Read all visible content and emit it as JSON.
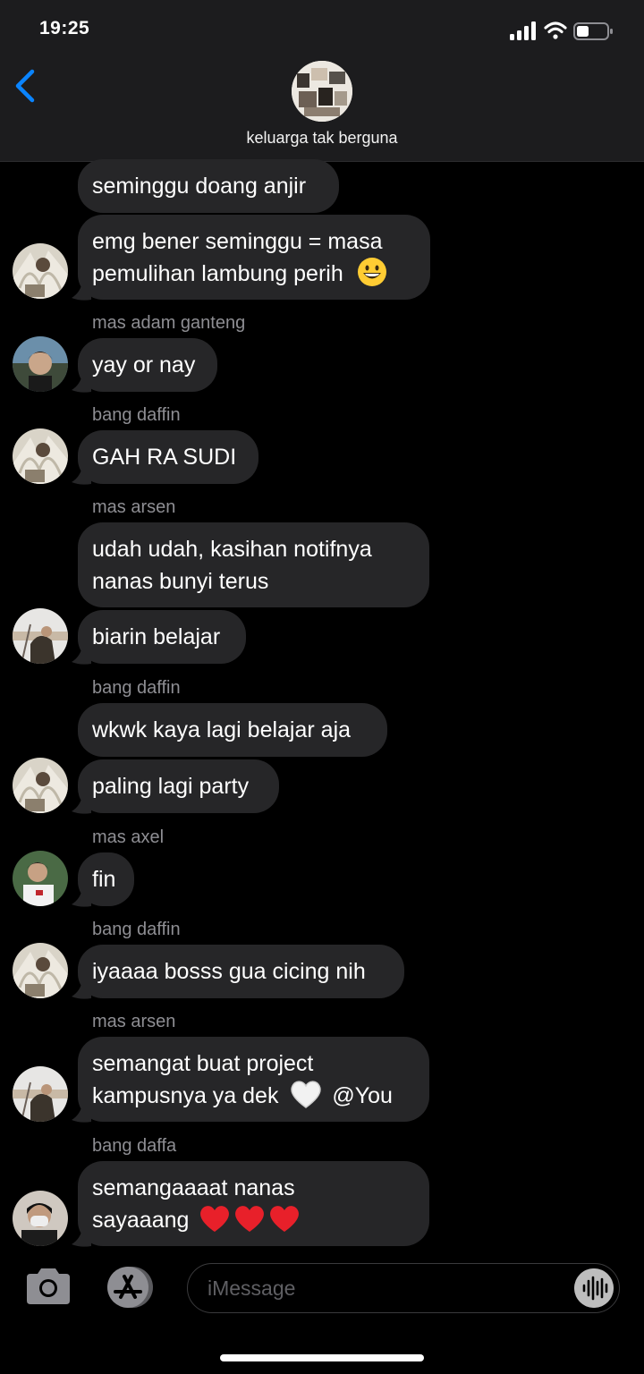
{
  "status": {
    "time": "19:25"
  },
  "header": {
    "group_name": "keluarga tak berguna"
  },
  "messages": [
    {
      "text": "seminggu doang anjir"
    },
    {
      "text_line1": "emg bener seminggu = masa",
      "text_line2": "pemulihan lambung perih",
      "emoji": "grinning-face"
    },
    {
      "sender": "mas adam ganteng",
      "text": "yay or nay"
    },
    {
      "sender": "bang daffin",
      "text": "GAH RA SUDI"
    },
    {
      "sender": "mas arsen",
      "text_line1": "udah udah, kasihan notifnya",
      "text_line2": "nanas bunyi terus"
    },
    {
      "text": "biarin belajar"
    },
    {
      "sender": "bang daffin",
      "text": "wkwk kaya lagi belajar aja"
    },
    {
      "text": "paling lagi party"
    },
    {
      "sender": "mas axel",
      "text": "fin"
    },
    {
      "sender": "bang daffin",
      "text": "iyaaaa bosss gua cicing nih"
    },
    {
      "sender": "mas arsen",
      "text_line1": "semangat buat project",
      "text_line2_a": "kampusnya ya dek",
      "emoji": "white-heart",
      "mention": "@You"
    },
    {
      "sender": "bang daffa",
      "text_line1": "semangaaaat nanas",
      "text_line2": "sayaaang",
      "emoji": "red-hearts"
    }
  ],
  "composer": {
    "placeholder": "iMessage"
  },
  "colors": {
    "bubble": "#262628",
    "accent": "#0a84ff",
    "header_bg": "#1c1c1e"
  }
}
